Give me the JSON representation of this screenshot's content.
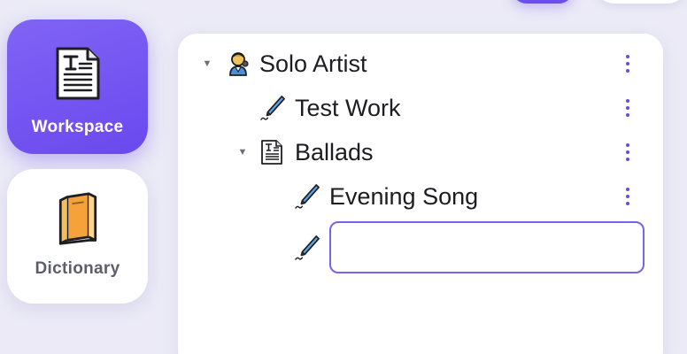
{
  "sidebar": {
    "items": [
      {
        "label": "Workspace",
        "icon": "document-icon",
        "active": true
      },
      {
        "label": "Dictionary",
        "icon": "book-icon",
        "active": false
      }
    ]
  },
  "tree": {
    "nodes": [
      {
        "label": "Solo Artist",
        "icon": "singer-icon",
        "expanded": true
      },
      {
        "label": "Test Work",
        "icon": "pen-icon"
      },
      {
        "label": "Ballads",
        "icon": "document-icon",
        "expanded": true
      },
      {
        "label": "Evening Song",
        "icon": "pen-icon"
      }
    ],
    "new_item": {
      "icon": "pen-icon",
      "value": "",
      "placeholder": ""
    }
  },
  "colors": {
    "accent": "#6c4df0",
    "background": "#ebeaf6",
    "card": "#ffffff",
    "input_border": "#7b62e8"
  }
}
